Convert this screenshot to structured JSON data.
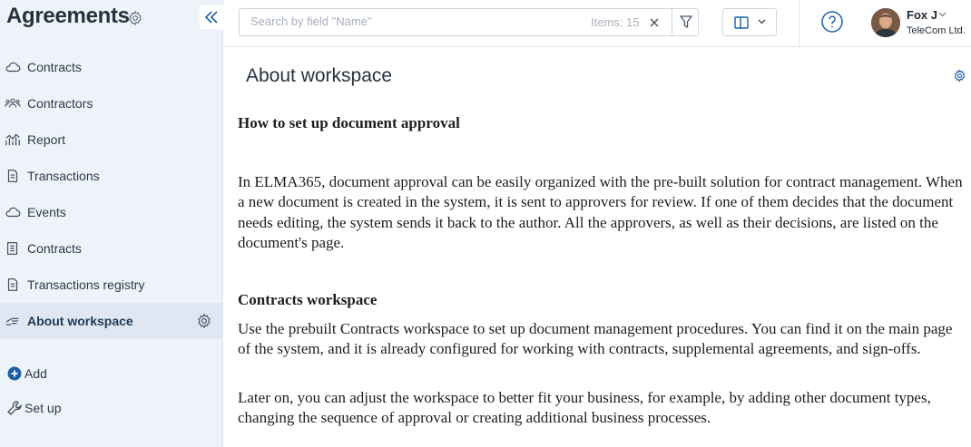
{
  "sidebar": {
    "title": "Agreements",
    "items": [
      {
        "label": "Contracts",
        "icon": "cloud-icon"
      },
      {
        "label": "Contractors",
        "icon": "users-icon"
      },
      {
        "label": "Report",
        "icon": "report-icon"
      },
      {
        "label": "Transactions",
        "icon": "document-icon"
      },
      {
        "label": "Events",
        "icon": "cloud-icon"
      },
      {
        "label": "Contracts",
        "icon": "list-document-icon"
      },
      {
        "label": "Transactions registry",
        "icon": "document-icon"
      },
      {
        "label": "About workspace",
        "icon": "hand-icon",
        "active": true
      }
    ],
    "add_label": "Add",
    "setup_label": "Set up"
  },
  "search": {
    "placeholder": "Search by field \"Name\"",
    "value": "",
    "items_count": "Items: 15"
  },
  "user": {
    "name": "Fox J",
    "company": "TeleCom Ltd."
  },
  "page": {
    "title": "About workspace"
  },
  "article": {
    "heading1": "How to set up document approval",
    "para1": "In ELMA365, document approval can be easily organized with the pre-built solution for contract management. When a new document is created in the system, it is sent to approvers for review. If one of them decides that the document needs editing, the system sends it back to the author. All the approvers, as well as their decisions, are listed on the document's page.",
    "heading2": "Contracts workspace",
    "para2": "Use the prebuilt Contracts workspace to set up document management procedures. You can find it on the main page of the system, and it is already configured for working with contracts, supplemental agreements, and sign-offs.",
    "para3": "Later on, you can adjust the workspace to better fit your business, for example, by adding other document types, changing the sequence of approval or creating additional business processes."
  },
  "colors": {
    "sidebar_bg": "#eef3fa",
    "active_item_bg": "#dfe7f2",
    "accent": "#1f5fa6"
  }
}
